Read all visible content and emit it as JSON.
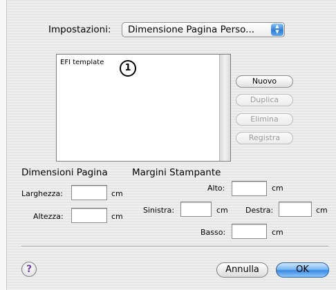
{
  "settings": {
    "label": "Impostazioni:",
    "selected": "Dimensione Pagina Perso..."
  },
  "list": {
    "items": [
      "EFI template"
    ],
    "callout": "1"
  },
  "side_buttons": {
    "new": "Nuovo",
    "duplicate": "Duplica",
    "delete": "Elimina",
    "save": "Registra"
  },
  "page_size": {
    "title": "Dimensioni Pagina",
    "width_label": "Larghezza:",
    "width_value": "",
    "width_unit": "cm",
    "height_label": "Altezza:",
    "height_value": "",
    "height_unit": "cm"
  },
  "margins": {
    "title": "Margini Stampante",
    "top_label": "Alto:",
    "top_value": "",
    "top_unit": "cm",
    "left_label": "Sinistra:",
    "left_value": "",
    "left_unit": "cm",
    "right_label": "Destra:",
    "right_value": "",
    "right_unit": "cm",
    "bottom_label": "Basso:",
    "bottom_value": "",
    "bottom_unit": "cm"
  },
  "footer": {
    "help": "?",
    "cancel": "Annulla",
    "ok": "OK"
  },
  "colors": {
    "accent": "#3a8ae2",
    "callout_border": "#000000"
  },
  "icons": {
    "popup": "popup-arrows-icon",
    "help": "help-icon"
  }
}
